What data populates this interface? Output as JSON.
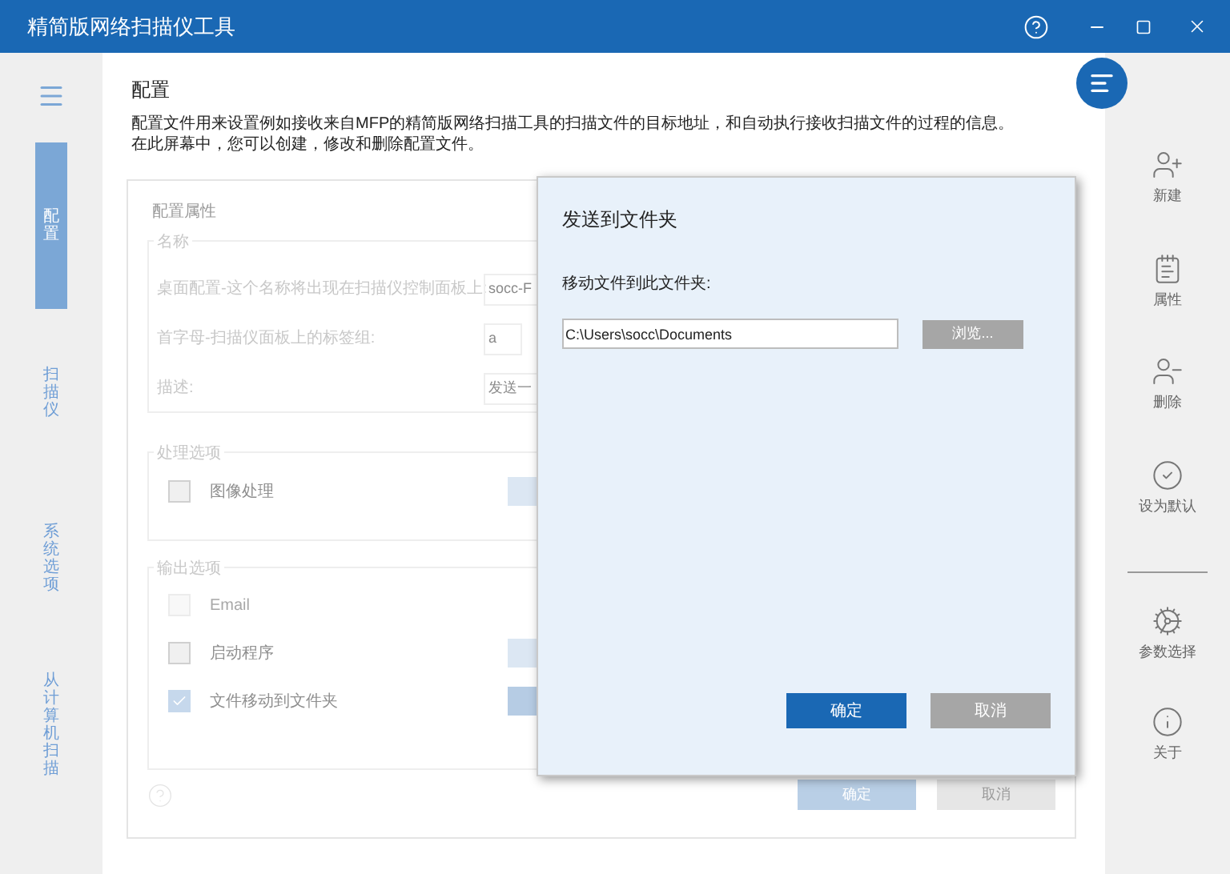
{
  "window": {
    "title": "精简版网络扫描仪工具"
  },
  "nav": [
    {
      "label": "配置",
      "selected": true
    },
    {
      "label": "扫描仪",
      "selected": false
    },
    {
      "label": "系统选项",
      "selected": false
    },
    {
      "label": "从计算机扫描",
      "selected": false
    }
  ],
  "page": {
    "title": "配置",
    "description": [
      "配置文件用来设置例如接收来自MFP的精简版网络扫描工具的扫描文件的目标地址，和自动执行接收扫描文件的过程的信息。",
      "在此屏幕中，您可以创建，修改和删除配置文件。"
    ]
  },
  "profile_panel": {
    "title": "配置属性",
    "name_group": {
      "legend": "名称",
      "fields": [
        {
          "label": "桌面配置-这个名称将出现在扫描仪控制面板上:",
          "value": "socc-F"
        },
        {
          "label": "首字母-扫描仪面板上的标签组:",
          "value": "a"
        },
        {
          "label": "描述:",
          "value": "发送一"
        }
      ]
    },
    "processing": {
      "legend": "处理选项",
      "options": [
        {
          "label": "图像处理",
          "checked": false,
          "disabled": false,
          "settings_button": true
        }
      ]
    },
    "output": {
      "legend": "输出选项",
      "options": [
        {
          "label": "Email",
          "checked": false,
          "disabled": true,
          "settings_button": false
        },
        {
          "label": "启动程序",
          "checked": false,
          "disabled": false,
          "settings_button": true
        },
        {
          "label": "文件移动到文件夹",
          "checked": true,
          "disabled": false,
          "settings_button": true
        }
      ]
    },
    "buttons": [
      {
        "label": "确定",
        "kind": "primary"
      },
      {
        "label": "取消",
        "kind": "secondary"
      }
    ]
  },
  "dialog": {
    "title": "发送到文件夹",
    "label": "移动文件到此文件夹:",
    "path": "C:\\Users\\socc\\Documents",
    "browse": "浏览...",
    "buttons": [
      {
        "label": "确定",
        "kind": "primary"
      },
      {
        "label": "取消",
        "kind": "secondary"
      }
    ]
  },
  "actions": [
    {
      "label": "新建",
      "kind": "new"
    },
    {
      "label": "属性",
      "kind": "properties"
    },
    {
      "label": "删除",
      "kind": "delete"
    },
    {
      "label": "设为默认",
      "kind": "default"
    },
    {
      "label": "参数选择",
      "kind": "preferences"
    },
    {
      "label": "关于",
      "kind": "about"
    }
  ]
}
